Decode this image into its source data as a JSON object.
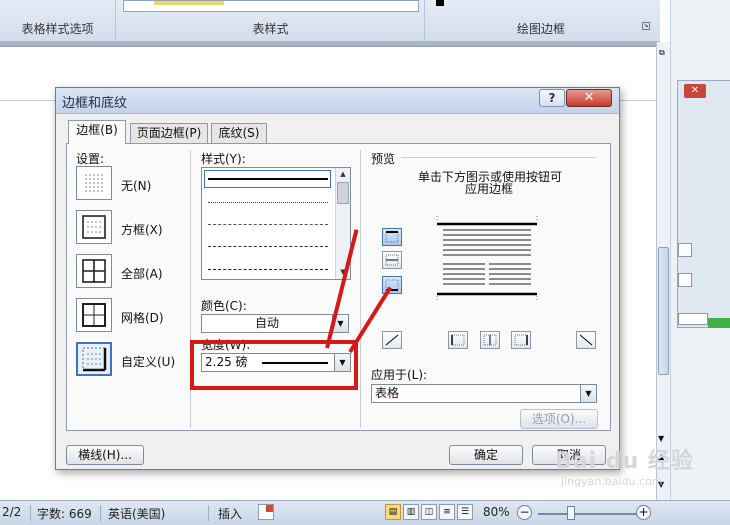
{
  "ribbon": {
    "groups": [
      "表格样式选项",
      "表样式",
      "绘图边框"
    ]
  },
  "dialog": {
    "title": "边框和底纹",
    "help": "?",
    "close": "✕",
    "tabs": [
      "边框(B)",
      "页面边框(P)",
      "底纹(S)"
    ],
    "settings": {
      "label": "设置:",
      "items": [
        "无(N)",
        "方框(X)",
        "全部(A)",
        "网格(D)",
        "自定义(U)"
      ]
    },
    "style_label": "样式(Y):",
    "color_label": "颜色(C):",
    "color_value": "自动",
    "width_label": "宽度(W):",
    "width_value": "2.25 磅",
    "preview": {
      "label": "预览",
      "hint_line1": "单击下方图示或使用按钮可",
      "hint_line2": "应用边框"
    },
    "apply_label": "应用于(L):",
    "apply_value": "表格",
    "options_button": "选项(O)...",
    "hline_button": "横线(H)...",
    "ok_button": "确定",
    "cancel_button": "取消"
  },
  "statusbar": {
    "page": "2/2",
    "words": "字数: 669",
    "language": "英语(美国)",
    "mode": "插入",
    "zoom": "80%"
  },
  "watermark": {
    "brand": "Bai du 经验",
    "url": "jingyan.baidu.com"
  },
  "colors": {
    "highlight": "#d51818",
    "accent": "#3b74c4"
  }
}
